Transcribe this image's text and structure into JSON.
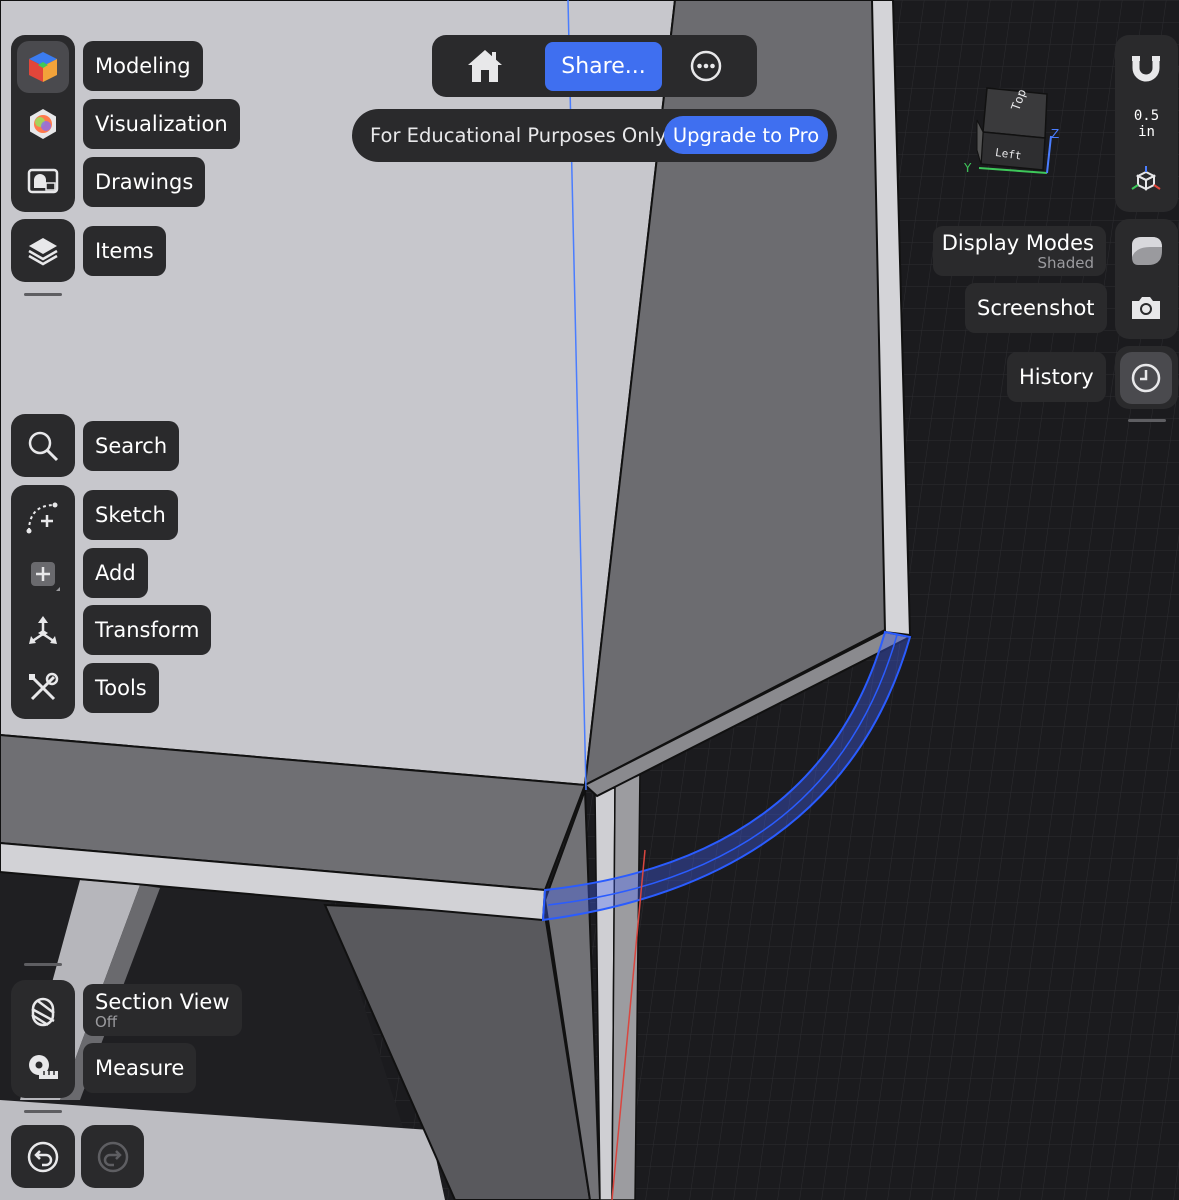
{
  "left_toolbar": {
    "workspaces": [
      {
        "label": "Modeling",
        "icon": "modeling-cube-icon",
        "active": true
      },
      {
        "label": "Visualization",
        "icon": "color-sphere-icon"
      },
      {
        "label": "Drawings",
        "icon": "drawings-icon"
      }
    ],
    "items_label": "Items",
    "search_label": "Search",
    "tools": [
      {
        "label": "Sketch",
        "icon": "sketch-icon"
      },
      {
        "label": "Add",
        "icon": "add-icon"
      },
      {
        "label": "Transform",
        "icon": "transform-icon"
      },
      {
        "label": "Tools",
        "icon": "wrench-screwdriver-icon"
      }
    ],
    "section_view": {
      "label": "Section View",
      "state": "Off"
    },
    "measure_label": "Measure"
  },
  "top_bar": {
    "share_label": "Share...",
    "edu_notice": "For Educational Purposes Only",
    "upgrade_label": "Upgrade to Pro"
  },
  "right_toolbar": {
    "snap_value": "0.5",
    "snap_unit": "in",
    "display_modes": {
      "label": "Display Modes",
      "state": "Shaded"
    },
    "screenshot_label": "Screenshot",
    "history_label": "History"
  },
  "view_cube": {
    "top": "Top",
    "left": "Left",
    "axis_y": "Y",
    "axis_z": "Z"
  },
  "colors": {
    "accent": "#3f6ff0",
    "panel": "#2a2a2c",
    "selection": "#2a5cff"
  }
}
